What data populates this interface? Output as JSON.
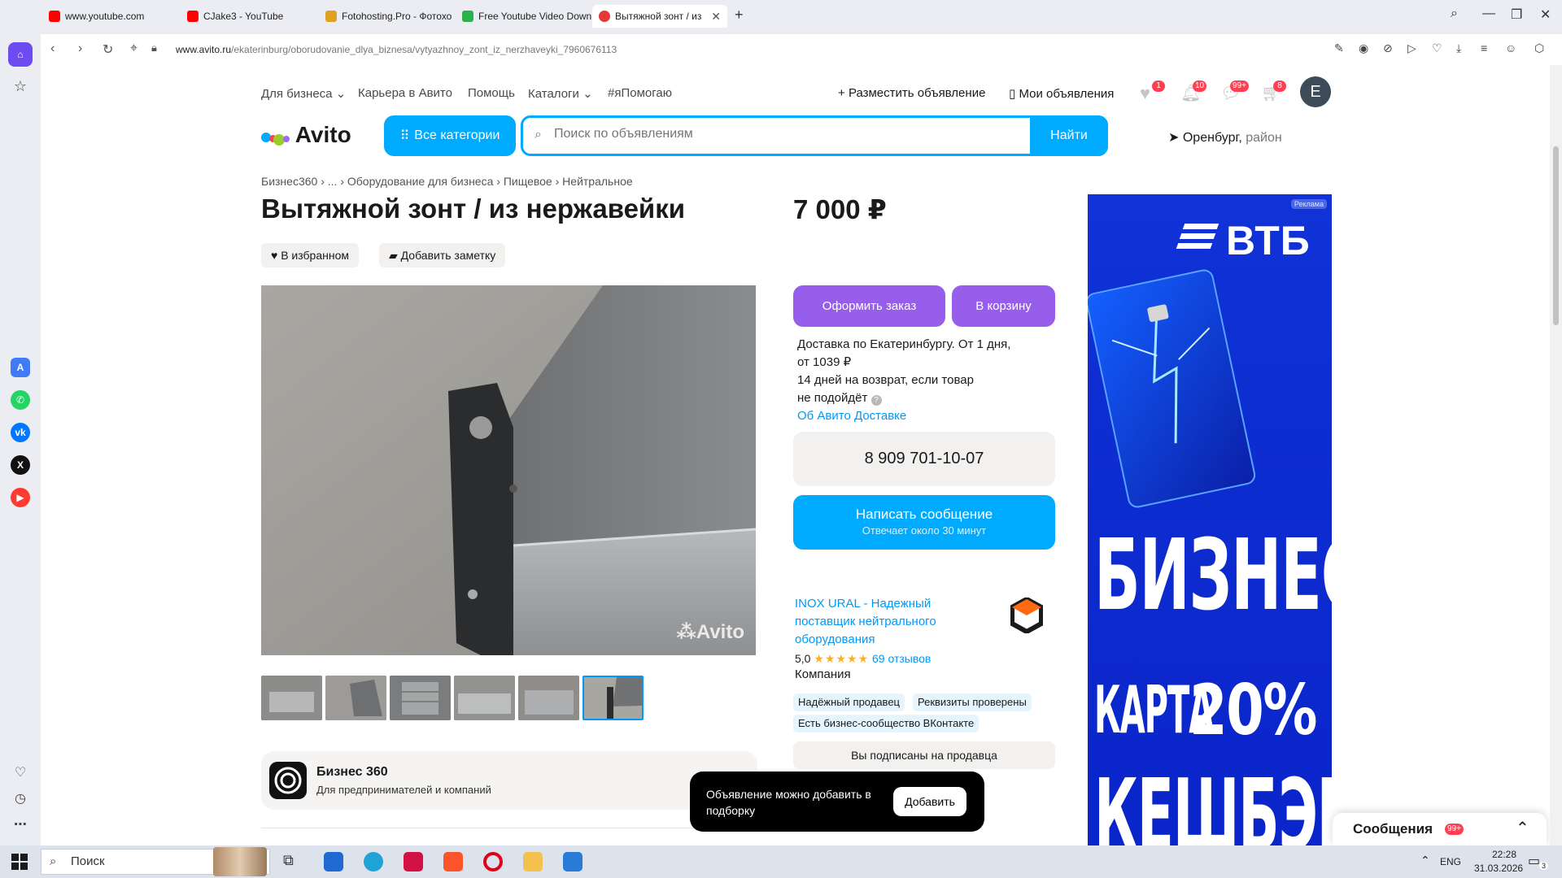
{
  "tabs": [
    {
      "title": "www.youtube.com",
      "color": "#ff0000"
    },
    {
      "title": "CJake3 - YouTube",
      "color": "#ff0000"
    },
    {
      "title": "Fotohosting.Pro - Фотохо",
      "color": "#e0a020"
    },
    {
      "title": "Free Youtube Video Down",
      "color": "#2bb24c"
    },
    {
      "title": "Вытяжной зонт / из нерж",
      "color": "#e53935",
      "active": true
    }
  ],
  "address": {
    "host": "www.avito.ru",
    "path": "/ekaterinburg/oborudovanie_dlya_biznesa/vytyazhnoy_zont_iz_nerzhaveyki_7960676113"
  },
  "topnav": {
    "business": "Для бизнеса",
    "career": "Карьера в Авито",
    "help": "Помощь",
    "catalogs": "Каталоги",
    "help_tag": "#яПомогаю",
    "post_ad": "Разместить объявление",
    "my_ads": "Мои объявления",
    "badges": {
      "favorites": "1",
      "notifications": "10",
      "messages": "99+",
      "cart": "8"
    },
    "avatar_letter": "E"
  },
  "header": {
    "logo": "Avito",
    "categories_button": "Все категории",
    "search_placeholder": "Поиск по объявлениям",
    "search_button": "Найти",
    "location": "Оренбург,",
    "location_suffix": " район"
  },
  "breadcrumbs": [
    "Бизнес360",
    "...",
    "Оборудование для бизнеса",
    "Пищевое",
    "Нейтральное"
  ],
  "product": {
    "title": "Вытяжной зонт / из нержавейки",
    "price": "7 000 ₽",
    "favorite_chip": "В избранном",
    "note_chip": "Добавить заметку",
    "watermark": "Avito",
    "thumbs_count": 6,
    "selected_thumb": 6
  },
  "business360": {
    "title": "Бизнес 360",
    "subtitle": "Для предпринимателей и компаний"
  },
  "order": {
    "order_button": "Оформить заказ",
    "cart_button": "В корзину",
    "delivery_line1": "Доставка по Екатеринбургу. От 1 дня,",
    "delivery_line2": "от 1039 ₽",
    "return_line1": "14 дней на возврат, если товар",
    "return_line2": "не подойдёт",
    "delivery_link": "Об Авито Доставке",
    "phone": "8 909 701-10-07",
    "message_button": "Написать сообщение",
    "message_sub": "Отвечает около 30 минут"
  },
  "seller": {
    "name": "INOX URAL - Надежный поставщик нейтрального оборудования",
    "rating": "5,0",
    "stars": "★★★★★",
    "reviews": "69 отзывов",
    "type": "Компания",
    "tags": [
      "Надёжный продавец",
      "Реквизиты проверены",
      "Есть бизнес-сообщество ВКонтакте"
    ],
    "subscribed": "Вы подписаны на продавца"
  },
  "ad": {
    "label": "Реклама",
    "brand": "ВТБ",
    "word1": "БИЗНЕС",
    "word2": "КАРТА",
    "percent": "20%",
    "word3": "КЕШБЭК"
  },
  "toast": {
    "text": "Объявление можно добавить в подборку",
    "button": "Добавить"
  },
  "messenger": {
    "title": "Сообщения",
    "badge": "99+"
  },
  "taskbar": {
    "search": "Поиск",
    "lang": "ENG",
    "time": "22:28",
    "date": "31.03.2026",
    "notif": "3"
  }
}
